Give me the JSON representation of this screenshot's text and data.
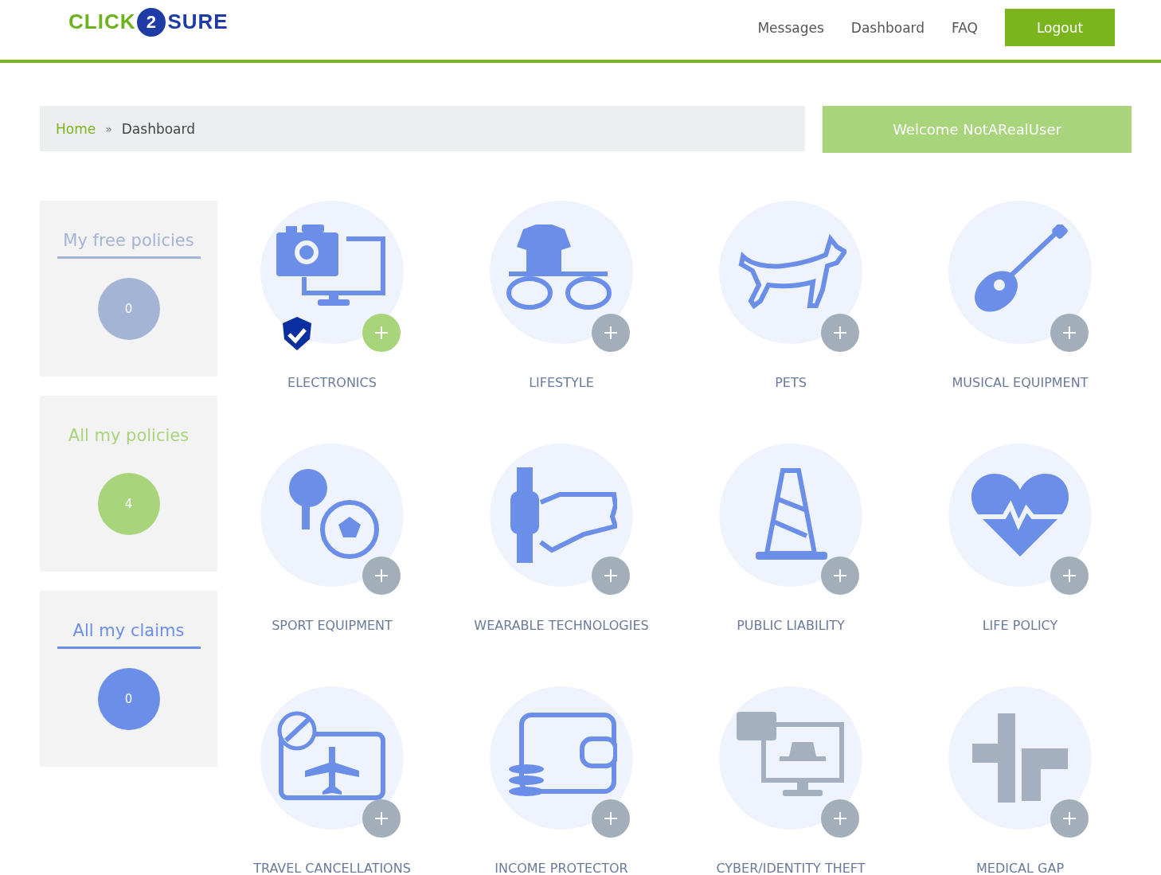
{
  "logo": {
    "left": "CLICK",
    "mark": "2",
    "right": "SURE"
  },
  "nav": {
    "links": [
      "Messages",
      "Dashboard",
      "FAQ"
    ],
    "button": "Logout"
  },
  "breadcrumb": {
    "items": [
      "Home",
      "Dashboard"
    ],
    "separator": "»"
  },
  "welcome": "Welcome NotARealUser",
  "stats": [
    {
      "title": "My free policies",
      "count": "0",
      "color": "#a4b4d4",
      "underlined": true
    },
    {
      "title": "All my policies",
      "count": "4",
      "color": "#a8d47c",
      "underlined": false
    },
    {
      "title": "All my claims",
      "count": "0",
      "color": "#6b8fe8",
      "underlined": true
    }
  ],
  "products": [
    {
      "label": "ELECTRONICS",
      "kind": "electronics",
      "available": true,
      "insured": true
    },
    {
      "label": "LIFESTYLE",
      "kind": "lifestyle",
      "available": true,
      "insured": false
    },
    {
      "label": "PETS",
      "kind": "pets",
      "available": true,
      "insured": false
    },
    {
      "label": "MUSICAL EQUIPMENT",
      "kind": "music",
      "available": true,
      "insured": false
    },
    {
      "label": "SPORT EQUIPMENT",
      "kind": "sport",
      "available": true,
      "insured": false
    },
    {
      "label": "WEARABLE TECHNOLOGIES",
      "kind": "wearable",
      "available": true,
      "insured": false
    },
    {
      "label": "PUBLIC LIABILITY",
      "kind": "liability",
      "available": true,
      "insured": false
    },
    {
      "label": "LIFE POLICY",
      "kind": "life",
      "available": true,
      "insured": false
    },
    {
      "label": "TRAVEL CANCELLATIONS",
      "kind": "travel",
      "available": true,
      "insured": false
    },
    {
      "label": "INCOME PROTECTOR",
      "kind": "income",
      "available": true,
      "insured": false
    },
    {
      "label": "CYBER/IDENTITY THEFT",
      "kind": "cyber",
      "available": false,
      "insured": false
    },
    {
      "label": "MEDICAL GAP",
      "kind": "medical",
      "available": false,
      "insured": false
    }
  ]
}
